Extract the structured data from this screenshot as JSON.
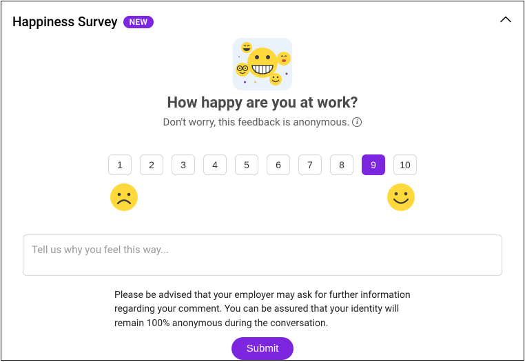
{
  "header": {
    "title": "Happiness Survey",
    "badge": "NEW"
  },
  "question": "How happy are you at work?",
  "subtext": "Don't worry, this feedback is anonymous.",
  "scale": {
    "options": [
      "1",
      "2",
      "3",
      "4",
      "5",
      "6",
      "7",
      "8",
      "9",
      "10"
    ],
    "selected": "9"
  },
  "comment": {
    "placeholder": "Tell us why you feel this way...",
    "value": ""
  },
  "disclaimer": "Please be advised that your employer may ask for further information regarding your comment. You can be assured that your identity will remain 100% anonymous during the conversation.",
  "submit_label": "Submit"
}
